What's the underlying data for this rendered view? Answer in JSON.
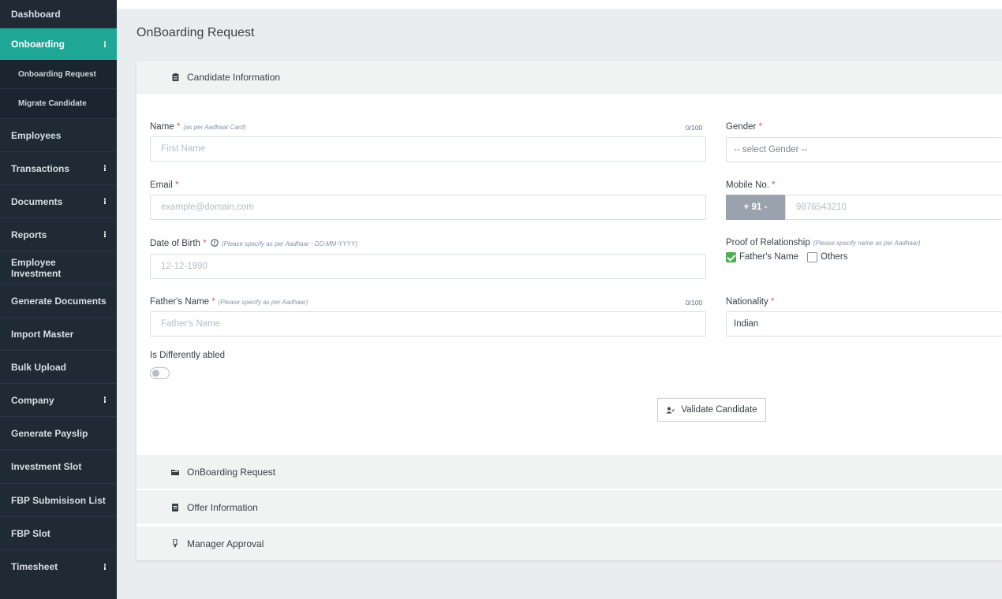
{
  "sidebar": {
    "items": [
      {
        "label": "Dashboard",
        "kebab": ""
      },
      {
        "label": "Onboarding",
        "kebab": "⁝"
      },
      {
        "label": "Onboarding Request",
        "kebab": ""
      },
      {
        "label": "Migrate Candidate",
        "kebab": ""
      },
      {
        "label": "Employees",
        "kebab": ""
      },
      {
        "label": "Transactions",
        "kebab": "⁝"
      },
      {
        "label": "Documents",
        "kebab": "⁝"
      },
      {
        "label": "Reports",
        "kebab": "⁝"
      },
      {
        "label": "Employee Investment",
        "kebab": ""
      },
      {
        "label": "Generate Documents",
        "kebab": ""
      },
      {
        "label": "Import Master",
        "kebab": ""
      },
      {
        "label": "Bulk Upload",
        "kebab": ""
      },
      {
        "label": "Company",
        "kebab": "⁝"
      },
      {
        "label": "Generate Payslip",
        "kebab": ""
      },
      {
        "label": "Investment Slot",
        "kebab": ""
      },
      {
        "label": "FBP Submisison List",
        "kebab": ""
      },
      {
        "label": "FBP Slot",
        "kebab": ""
      },
      {
        "label": "Timesheet",
        "kebab": "⁝"
      }
    ],
    "active_color": "#1fa796"
  },
  "page": {
    "title": "OnBoarding Request"
  },
  "sections": {
    "candidate": "Candidate Information",
    "onboarding": "OnBoarding Request",
    "offer": "Offer Information",
    "manager": "Manager Approval"
  },
  "form": {
    "required_mark": "*",
    "name": {
      "label": "Name",
      "hint": "(as per Aadhaar Card)",
      "counter": "0/100",
      "placeholder": "First Name"
    },
    "gender": {
      "label": "Gender",
      "value": "-- select Gender --"
    },
    "email": {
      "label": "Email",
      "placeholder": "example@domain.com"
    },
    "mobile": {
      "label": "Mobile No.",
      "country_code": "+ 91  -",
      "placeholder": "9876543210"
    },
    "dob": {
      "label": "Date of Birth",
      "hint": "(Please specify as per Aadhaar - DD-MM-YYYY)",
      "placeholder": "12-12-1990"
    },
    "proof": {
      "label": "Proof of Relationship",
      "hint": "(Please specify name as per Aadhaar)",
      "option_father": "Father's Name",
      "option_others": "Others",
      "father_checked": true,
      "others_checked": false
    },
    "father_name": {
      "label": "Father's Name",
      "hint": "(Please specify as per Aadhaar)",
      "counter": "0/100",
      "placeholder": "Father's Name"
    },
    "nationality": {
      "label": "Nationality",
      "value": "Indian"
    },
    "differently_abled": {
      "label": "Is Differently abled",
      "on": false
    },
    "validate_button": "Validate Candidate"
  }
}
